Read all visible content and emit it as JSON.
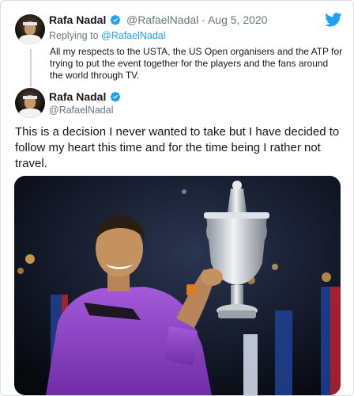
{
  "reply_tweet": {
    "author_name": "Rafa Nadal",
    "handle": "@RafaelNadal",
    "separator": "·",
    "date": "Aug 5, 2020",
    "replying_prefix": "Replying to",
    "replying_handle": "@RafaelNadal",
    "text": "All my respects to the USTA, the US Open organisers and the ATP for trying to put the event together for the players and the fans around the world through TV."
  },
  "main_tweet": {
    "author_name": "Rafa Nadal",
    "handle": "@RafaelNadal",
    "text": "This is a decision I never wanted to take but I have decided to follow my heart this time and for the time being I rather not travel."
  },
  "icons": {
    "brand": "twitter-bird-icon",
    "verified": "verified-badge-icon"
  },
  "colors": {
    "accent": "#1da1f2",
    "text": "#14171a",
    "secondary_text": "#657786",
    "shirt": "#8e3fc7"
  }
}
